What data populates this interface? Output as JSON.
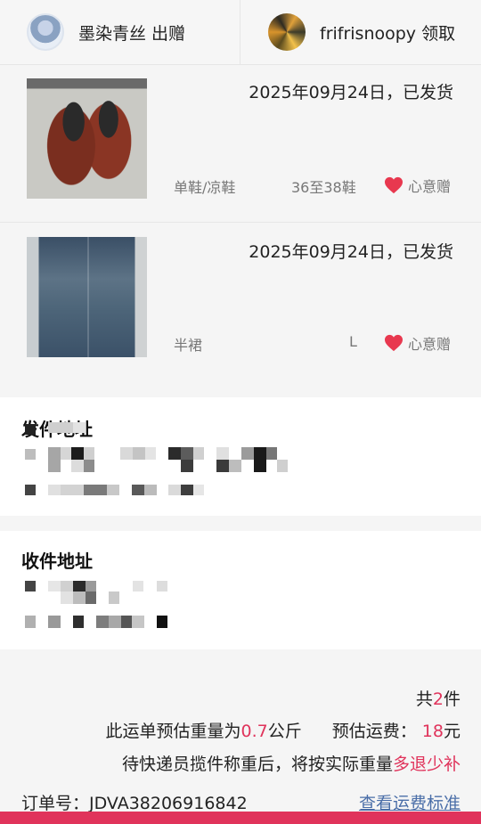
{
  "header": {
    "sender_label": "墨染青丝 出赠",
    "receiver_label": "frifrisnoopy 领取"
  },
  "items": [
    {
      "date_status": "2025年09月24日，已发货",
      "category": "单鞋/凉鞋",
      "size": "36至38鞋",
      "gift_label": "心意赠"
    },
    {
      "date_status": "2025年09月24日，已发货",
      "category": "半裙",
      "size": "L",
      "gift_label": "心意赠"
    }
  ],
  "sender_address": {
    "title": "发件地址"
  },
  "receiver_address": {
    "title": "收件地址"
  },
  "summary": {
    "count_prefix": "共",
    "count": "2",
    "count_suffix": "件",
    "weight_prefix": "此运单预估重量为",
    "weight": "0.7",
    "weight_unit": "公斤",
    "fee_label": "预估运费：",
    "fee": "18",
    "fee_unit": "元",
    "note_prefix": "待快递员揽件称重后，将按实际重量",
    "note_highlight": "多退少补"
  },
  "order": {
    "label": "订单号：",
    "number": "JDVA38206916842",
    "link_label": "查看运费标准"
  },
  "colors": {
    "accent": "#e0335b",
    "link": "#4a6ea8",
    "heart": "#e8384f"
  }
}
